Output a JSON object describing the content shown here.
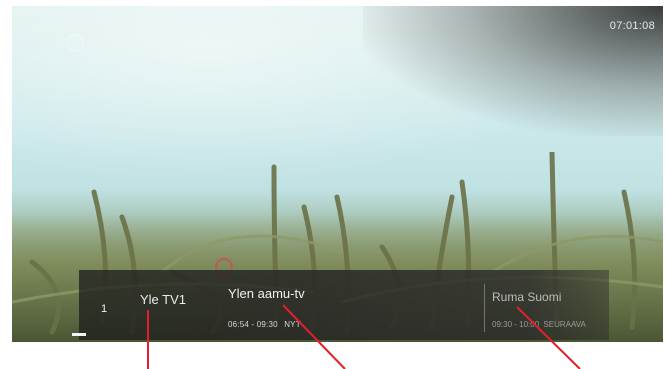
{
  "clock": "07:01:08",
  "channel": {
    "number": "1",
    "name": "Yle TV1"
  },
  "now_program": {
    "title": "Ylen aamu-tv",
    "time": "06:54 - 09:30",
    "status": "NYT"
  },
  "next_program": {
    "title": "Ruma Suomi",
    "time": "09:30 - 10:00",
    "status": "SEURAAVA"
  },
  "colors": {
    "annotation": "#e0202a",
    "ring": "#d04a5a"
  }
}
